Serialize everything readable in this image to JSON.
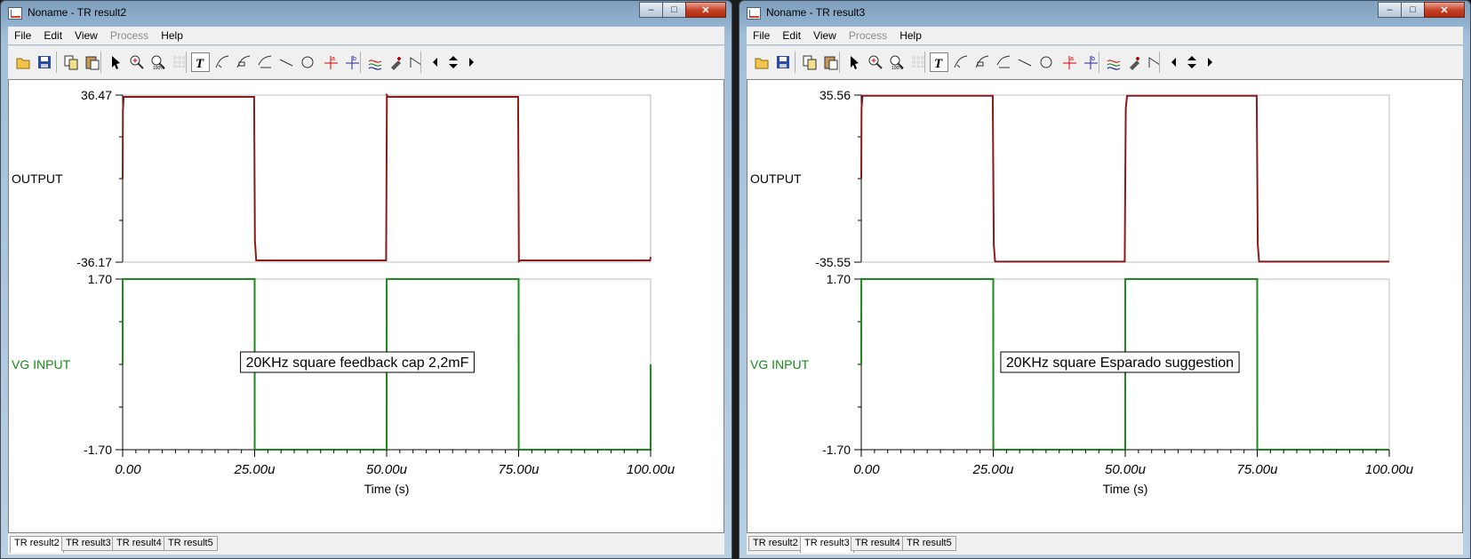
{
  "menu": [
    "File",
    "Edit",
    "View",
    "Process",
    "Help"
  ],
  "menu_disabled": [
    "Process"
  ],
  "caption_buttons": {
    "minimize": "‒",
    "maximize": "□",
    "close": "✕"
  },
  "toolbar_icons": [
    "open-icon",
    "save-icon",
    "copy-icon",
    "paste-icon",
    "pointer-icon",
    "zoom-in-icon",
    "zoom-100-icon",
    "grid-icon",
    "text-icon",
    "curve-label-icon",
    "curve-label2-icon",
    "curve-label3-icon",
    "line-icon",
    "circle-icon",
    "cursor-a-icon",
    "cursor-b-icon",
    "curves-icon",
    "probe-icon",
    "step-icon",
    "nav-left-icon",
    "nav-updown-icon",
    "nav-right-icon"
  ],
  "colors": {
    "output_trace": "#8b1a1a",
    "input_trace": "#1a8a1a",
    "input_label": "#138a13"
  },
  "windows": [
    {
      "title": "Noname - TR result2",
      "tabs": [
        "TR result2",
        "TR result3",
        "TR result4",
        "TR result5"
      ],
      "active_tab": 0,
      "annotation": "20KHz square feedback cap 2,2mF",
      "chart_data": {
        "type": "line",
        "xlabel": "Time (s)",
        "x_ticks": [
          "0.00",
          "25.00u",
          "50.00u",
          "75.00u",
          "100.00u"
        ],
        "x_range": [
          0,
          100
        ],
        "x_unit": "us",
        "panels": [
          {
            "name": "OUTPUT",
            "ylim": [
              -36.17,
              36.47
            ],
            "y_ticks": [
              "36.47",
              "-36.17"
            ],
            "x": [
              0,
              0.05,
              0.2,
              24.9,
              25.05,
              25.3,
              49.9,
              50.05,
              50.3,
              74.9,
              75.05,
              75.3,
              99.9,
              100
            ],
            "y": [
              0,
              30,
              35.7,
              35.7,
              -26.8,
              -35.4,
              -35.4,
              36.4,
              35.7,
              35.7,
              -35.8,
              -35.4,
              -35.4,
              -33.9
            ]
          },
          {
            "name": "VG INPUT",
            "ylim": [
              -1.7,
              1.7
            ],
            "y_ticks": [
              "1.70",
              "-1.70"
            ],
            "x": [
              0,
              0.01,
              25,
              25.01,
              50,
              50.01,
              75,
              75.01,
              100,
              100.01
            ],
            "y": [
              0,
              1.7,
              1.7,
              -1.7,
              -1.7,
              1.7,
              1.7,
              -1.7,
              -1.7,
              0
            ]
          }
        ]
      }
    },
    {
      "title": "Noname - TR result3",
      "tabs": [
        "TR result2",
        "TR result3",
        "TR result4",
        "TR result5"
      ],
      "active_tab": 1,
      "annotation": "20KHz square Esparado suggestion",
      "chart_data": {
        "type": "line",
        "xlabel": "Time (s)",
        "x_ticks": [
          "0.00",
          "25.00u",
          "50.00u",
          "75.00u",
          "100.00u"
        ],
        "x_range": [
          0,
          100
        ],
        "x_unit": "us",
        "panels": [
          {
            "name": "OUTPUT",
            "ylim": [
              -35.55,
              35.56
            ],
            "y_ticks": [
              "35.56",
              "-35.55"
            ],
            "x": [
              0,
              0.05,
              0.25,
              24.9,
              25.1,
              25.35,
              49.9,
              50.1,
              50.35,
              74.9,
              75.1,
              75.35,
              100
            ],
            "y": [
              0,
              30,
              35.3,
              35.3,
              -28,
              -35.3,
              -35.3,
              30,
              35.3,
              35.3,
              -28,
              -35.3,
              -35.3
            ]
          },
          {
            "name": "VG INPUT",
            "ylim": [
              -1.7,
              1.7
            ],
            "y_ticks": [
              "1.70",
              "-1.70"
            ],
            "x": [
              0,
              0.01,
              25,
              25.01,
              50,
              50.01,
              75,
              75.01,
              100
            ],
            "y": [
              0,
              1.7,
              1.7,
              -1.7,
              -1.7,
              1.7,
              1.7,
              -1.7,
              -1.7
            ]
          }
        ]
      }
    }
  ]
}
